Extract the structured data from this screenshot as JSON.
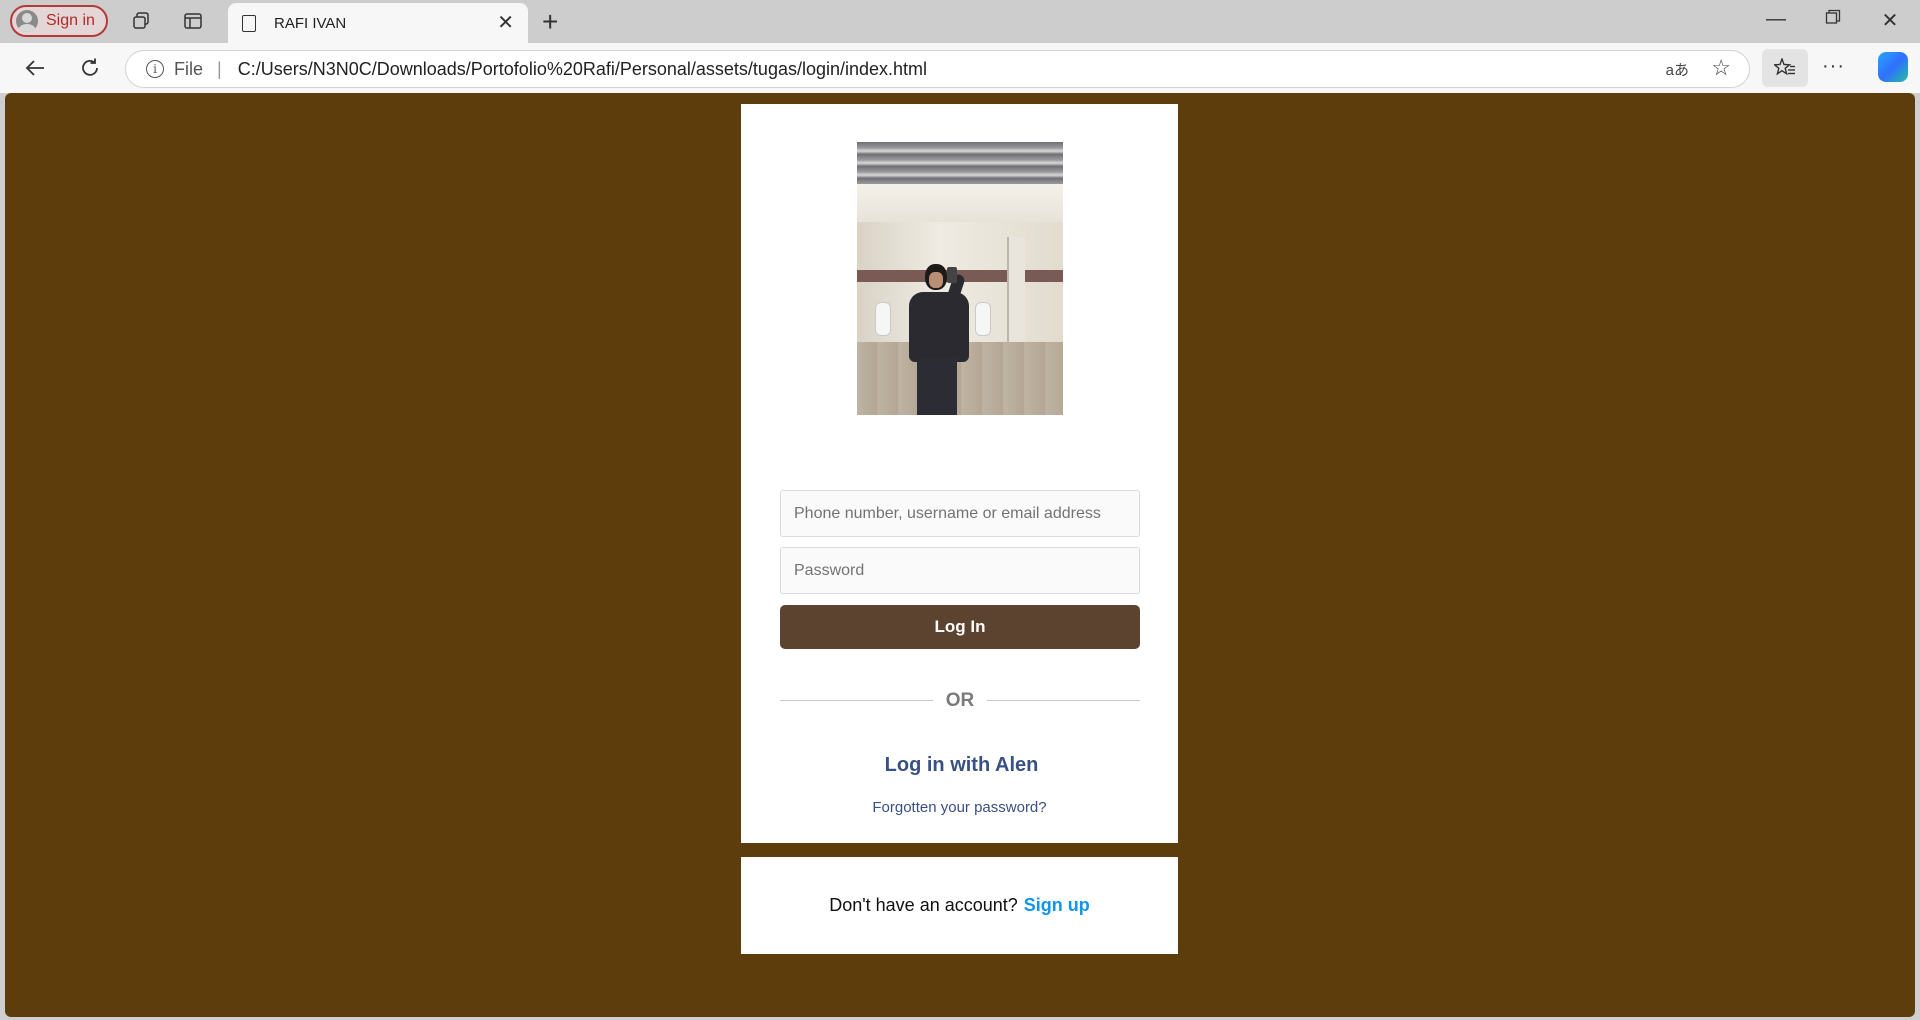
{
  "browser": {
    "profile_label": "Sign in",
    "tab_title": "RAFI IVAN",
    "address_scheme": "File",
    "address_url": "C:/Users/N3N0C/Downloads/Portofolio%20Rafi/Personal/assets/tugas/login/index.html",
    "translate_icon": "aあ"
  },
  "icons": {
    "workspaces": "workspaces-icon",
    "vertical_tabs": "vertical-tabs-icon",
    "page": "page-icon",
    "close": "close-icon",
    "new_tab": "plus-icon",
    "minimize": "minimize-icon",
    "restore": "restore-icon",
    "window_close": "window-close-icon",
    "back": "back-arrow-icon",
    "refresh": "refresh-icon",
    "info": "info-icon",
    "favorite": "star-icon",
    "favorites_list": "favorites-icon",
    "more": "more-icon",
    "copilot": "copilot-icon"
  },
  "colors": {
    "page_background": "#5e3d0c",
    "login_button": "#5b4330",
    "alt_login_link": "#385185",
    "signup_link": "#0f95f0"
  },
  "login": {
    "username_placeholder": "Phone number, username or email address",
    "password_placeholder": "Password",
    "login_button": "Log In",
    "divider_text": "OR",
    "alt_login": "Log in with Alen",
    "forgot_password": "Forgotten your password?"
  },
  "signup": {
    "prompt": "Don't have an account?",
    "link": "Sign up"
  }
}
